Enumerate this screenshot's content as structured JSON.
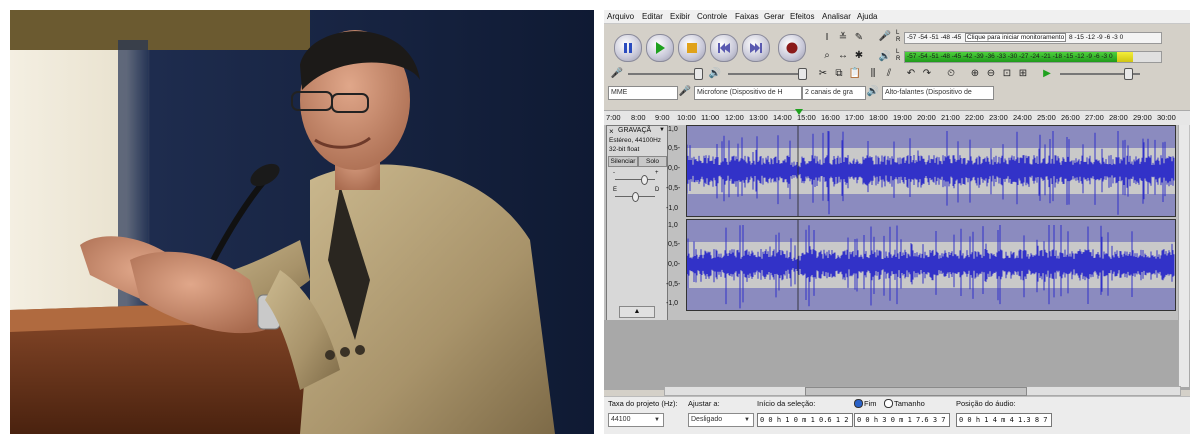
{
  "menu": [
    "Arquivo",
    "Editar",
    "Exibir",
    "Controle",
    "Faixas",
    "Gerar",
    "Efeitos",
    "Analisar",
    "Ajuda"
  ],
  "meter": {
    "record_scale": "-57 -54 -51 -48 -45",
    "record_hint": "Clique para iniciar monitoramento",
    "record_scale_right": "8 -15 -12 -9 -6 -3 0",
    "play_scale": "-57 -54 -51 -48 -45 -42 -39 -36 -33 -30 -27 -24 -21 -18 -15 -12 -9 -6 -3 0",
    "meter_l": "L",
    "meter_r": "R"
  },
  "device": {
    "host": "MME",
    "mic": "Microfone (Dispositivo de H",
    "channels": "2 canais de gra",
    "speakers": "Alto-falantes (Dispositivo de"
  },
  "ruler": [
    "7:00",
    "8:00",
    "9:00",
    "10:00",
    "11:00",
    "12:00",
    "13:00",
    "14:00",
    "15:00",
    "16:00",
    "17:00",
    "18:00",
    "19:00",
    "20:00",
    "21:00",
    "22:00",
    "23:00",
    "24:00",
    "25:00",
    "26:00",
    "27:00",
    "28:00",
    "29:00",
    "30:00"
  ],
  "track": {
    "close": "×",
    "name": "GRAVAÇÃ",
    "info1": "Estéreo, 44100Hz",
    "info2": "32-bit float",
    "mute": "Silenciar",
    "solo": "Solo",
    "gain_minus": "-",
    "gain_plus": "+",
    "pan_left": "E",
    "pan_right": "D",
    "scale": [
      "1,0",
      "0,5-",
      "0,0-",
      "-0,5-",
      "-1,0"
    ]
  },
  "selection": {
    "rate_label": "Taxa do projeto (Hz):",
    "rate_value": "44100",
    "snap_label": "Ajustar a:",
    "snap_value": "Desligado",
    "start_label": "Início da seleção:",
    "end_label": "Fim",
    "length_label": "Tamanho",
    "start_value": "0 0 h 1 0 m 1 0.6 1 2 s",
    "end_value": "0 0 h 3 0 m 1 7.6 3 7 s",
    "pos_label": "Posição do áudio:",
    "pos_value": "0 0 h 1 4 m 4 1.3 8 7 s"
  },
  "colors": {
    "wave": "#3232c8",
    "wave_bg": "#8b8bbf",
    "meter_green": "#2bb526"
  }
}
